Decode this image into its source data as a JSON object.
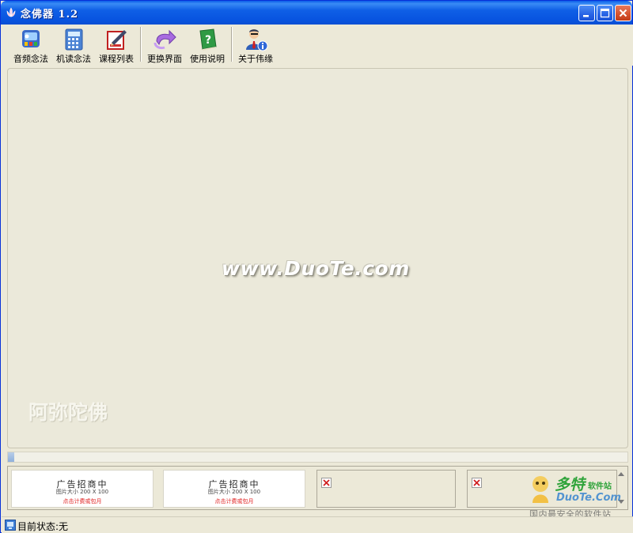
{
  "window": {
    "title": "念佛器 1.2"
  },
  "toolbar": {
    "items": [
      {
        "label": "音频念法",
        "icon": "media-player-icon"
      },
      {
        "label": "机读念法",
        "icon": "calculator-icon"
      },
      {
        "label": "课程列表",
        "icon": "edit-list-icon"
      },
      {
        "label": "更换界面",
        "icon": "change-arrow-icon"
      },
      {
        "label": "使用说明",
        "icon": "help-book-icon"
      },
      {
        "label": "关于伟缘",
        "icon": "user-info-icon"
      }
    ]
  },
  "main": {
    "watermark": "www.DuoTe.com",
    "buddha_text": "阿弥陀佛"
  },
  "progress": {
    "value": 0.01
  },
  "ads": [
    {
      "line1": "广告招商中",
      "line2": "图片大小 200 X 100",
      "line3": "点击计费或包月"
    },
    {
      "line1": "广告招商中",
      "line2": "图片大小 200 X 100",
      "line3": "点击计费或包月"
    }
  ],
  "logo": {
    "brand": "多特",
    "brand_suffix": "软件站",
    "site": "DuoTe.Com",
    "slogan": "国内最安全的软件站"
  },
  "status": {
    "text": "目前状态:无"
  },
  "colors": {
    "titlebar": "#0a5ce8",
    "window_bg": "#ece9d8",
    "close_button": "#d4502c"
  }
}
